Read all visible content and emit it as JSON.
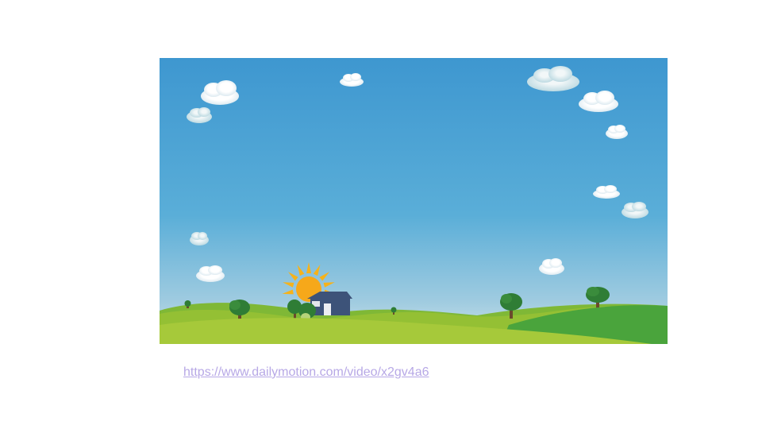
{
  "slide": {
    "video": {
      "scene": "cartoon-landscape",
      "colors": {
        "sky_top": "#3e97d0",
        "sky_bottom": "#c9e2ea",
        "hill_light": "#a9c73a",
        "hill_mid": "#8dbb30",
        "hill_dark": "#3f9f3d",
        "sun": "#f6b21a",
        "house": "#3d5379",
        "tree_foliage": "#2f7d35",
        "tree_trunk": "#6b4a2c",
        "cloud": "#ffffff"
      }
    },
    "link": {
      "text": "https://www.dailymotion.com/video/x2gv4a6",
      "color": "#b7a8e6"
    }
  }
}
